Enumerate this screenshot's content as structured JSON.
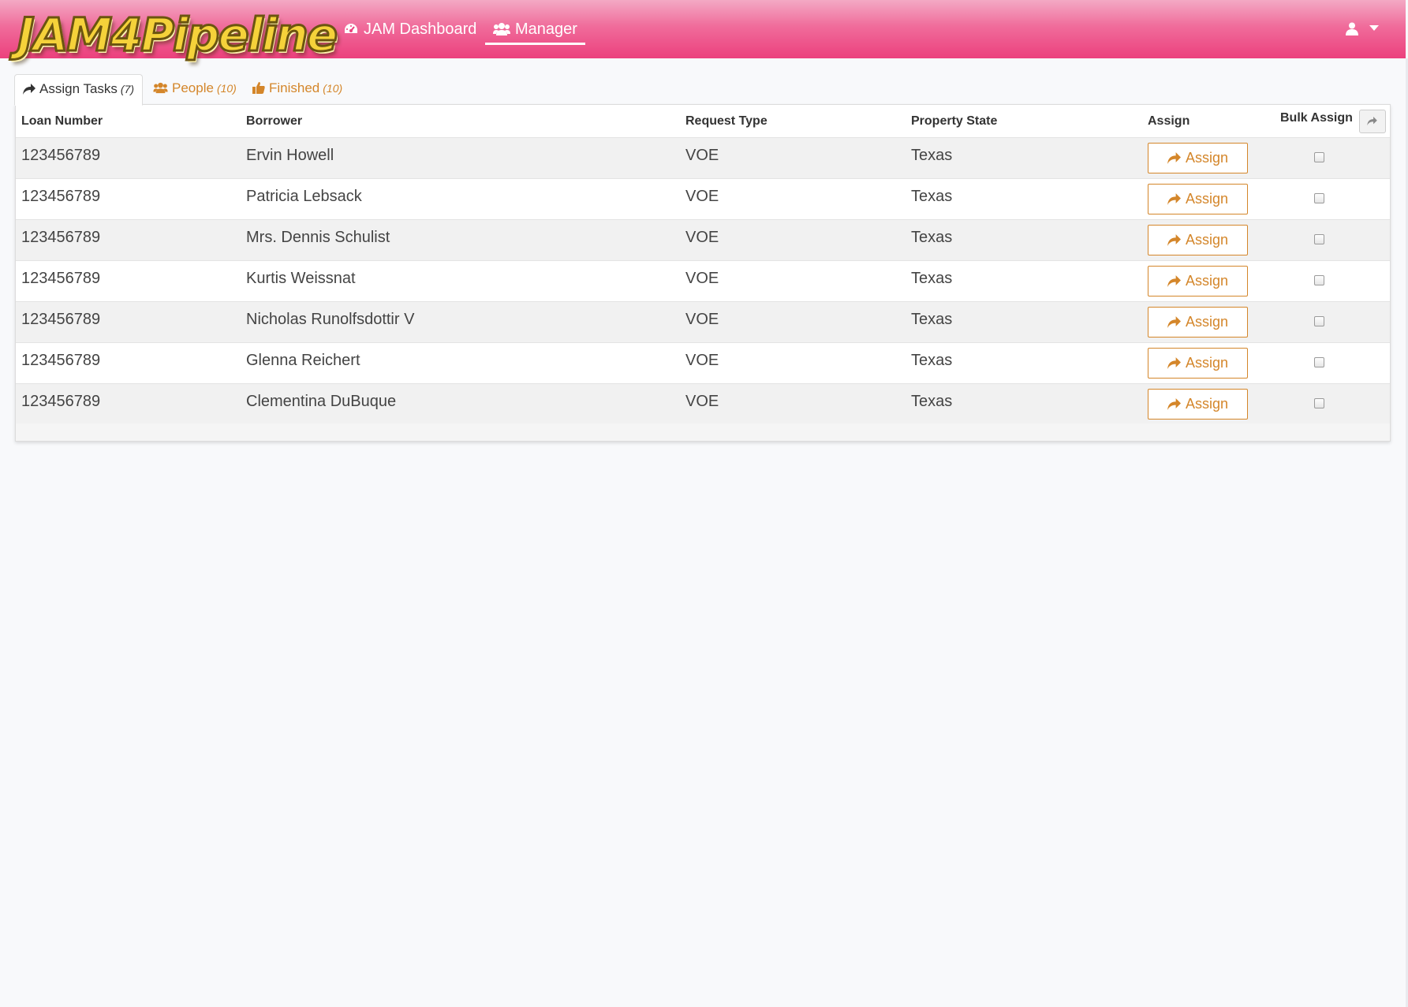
{
  "app": {
    "logo_text": "JAM4Pipeline"
  },
  "nav": {
    "items": [
      {
        "label": "JAM Dashboard",
        "icon": "dashboard-icon"
      },
      {
        "label": "Manager",
        "icon": "users-icon",
        "active": true
      }
    ],
    "user_icon": "user-icon"
  },
  "tabs": [
    {
      "label": "Assign Tasks",
      "count": "(7)",
      "icon": "share-icon",
      "active": true
    },
    {
      "label": "People",
      "count": "(10)",
      "icon": "users-icon"
    },
    {
      "label": "Finished",
      "count": "(10)",
      "icon": "thumbs-up-icon"
    }
  ],
  "table": {
    "columns": [
      "Loan Number",
      "Borrower",
      "Request Type",
      "Property State",
      "Assign",
      "Bulk Assign"
    ],
    "assign_label": "Assign",
    "rows": [
      {
        "loan": "123456789",
        "borrower": "Ervin Howell",
        "request_type": "VOE",
        "state": "Texas",
        "bulk": false
      },
      {
        "loan": "123456789",
        "borrower": "Patricia Lebsack",
        "request_type": "VOE",
        "state": "Texas",
        "bulk": false
      },
      {
        "loan": "123456789",
        "borrower": "Mrs. Dennis Schulist",
        "request_type": "VOE",
        "state": "Texas",
        "bulk": false
      },
      {
        "loan": "123456789",
        "borrower": "Kurtis Weissnat",
        "request_type": "VOE",
        "state": "Texas",
        "bulk": false
      },
      {
        "loan": "123456789",
        "borrower": "Nicholas Runolfsdottir V",
        "request_type": "VOE",
        "state": "Texas",
        "bulk": false
      },
      {
        "loan": "123456789",
        "borrower": "Glenna Reichert",
        "request_type": "VOE",
        "state": "Texas",
        "bulk": false
      },
      {
        "loan": "123456789",
        "borrower": "Clementina DuBuque",
        "request_type": "VOE",
        "state": "Texas",
        "bulk": false
      }
    ]
  },
  "colors": {
    "navbar": "#ec407d",
    "accent": "#d4862a"
  }
}
